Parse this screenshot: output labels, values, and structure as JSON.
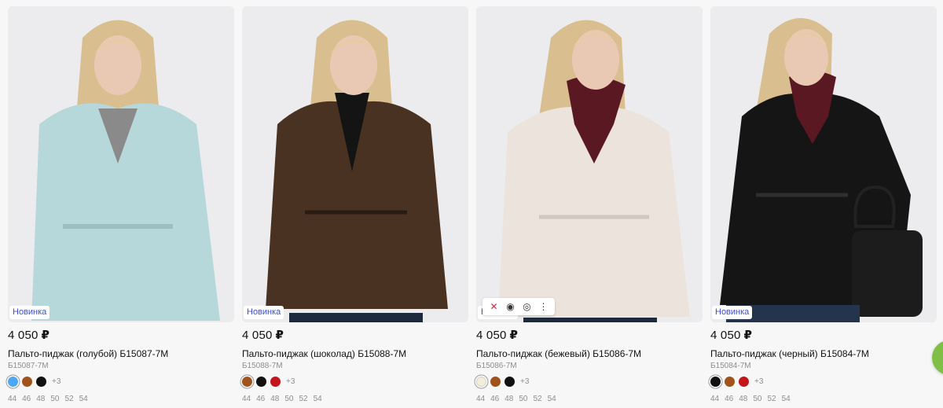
{
  "products": [
    {
      "badge": "Новинка",
      "price": "4 050",
      "currency": "₽",
      "title": "Пальто-пиджак (голубой) Б15087-7М",
      "sku": "Б15087-7М",
      "swatches": [
        "#4fa6f5",
        "#a0531a",
        "#111111"
      ],
      "more": "+3",
      "sizes": [
        "44",
        "46",
        "48",
        "50",
        "52",
        "54"
      ],
      "coat_color": "#b7d8da",
      "inner_color": "#8a8a8a"
    },
    {
      "badge": "Новинка",
      "price": "4 050",
      "currency": "₽",
      "title": "Пальто-пиджак (шоколад) Б15088-7М",
      "sku": "Б15088-7М",
      "swatches": [
        "#a0531a",
        "#111111",
        "#c4141c"
      ],
      "more": "+3",
      "sizes": [
        "44",
        "46",
        "48",
        "50",
        "52",
        "54"
      ],
      "coat_color": "#4a3223",
      "inner_color": "#141414"
    },
    {
      "badge": "Новинка",
      "price": "4 050",
      "currency": "₽",
      "title": "Пальто-пиджак (бежевый) Б15086-7М",
      "sku": "Б15086-7М",
      "swatches": [
        "#f1eedc",
        "#a0531a",
        "#111111"
      ],
      "more": "+3",
      "sizes": [
        "44",
        "46",
        "48",
        "50",
        "52",
        "54"
      ],
      "coat_color": "#ece4dc",
      "inner_color": "#5a1822"
    },
    {
      "badge": "Новинка",
      "price": "4 050",
      "currency": "₽",
      "title": "Пальто-пиджак (черный) Б15084-7М",
      "sku": "Б15084-7М",
      "swatches": [
        "#111111",
        "#a0531a",
        "#c4141c"
      ],
      "more": "+3",
      "sizes": [
        "44",
        "46",
        "48",
        "50",
        "52",
        "54"
      ],
      "coat_color": "#151515",
      "inner_color": "#5a1822"
    }
  ],
  "toolbar": {
    "icons": [
      "close-icon",
      "eye-icon",
      "camera-icon",
      "more-vertical-icon"
    ]
  },
  "colors": {
    "badge_text": "#3b4fd6",
    "fab": "#7fbf45"
  }
}
